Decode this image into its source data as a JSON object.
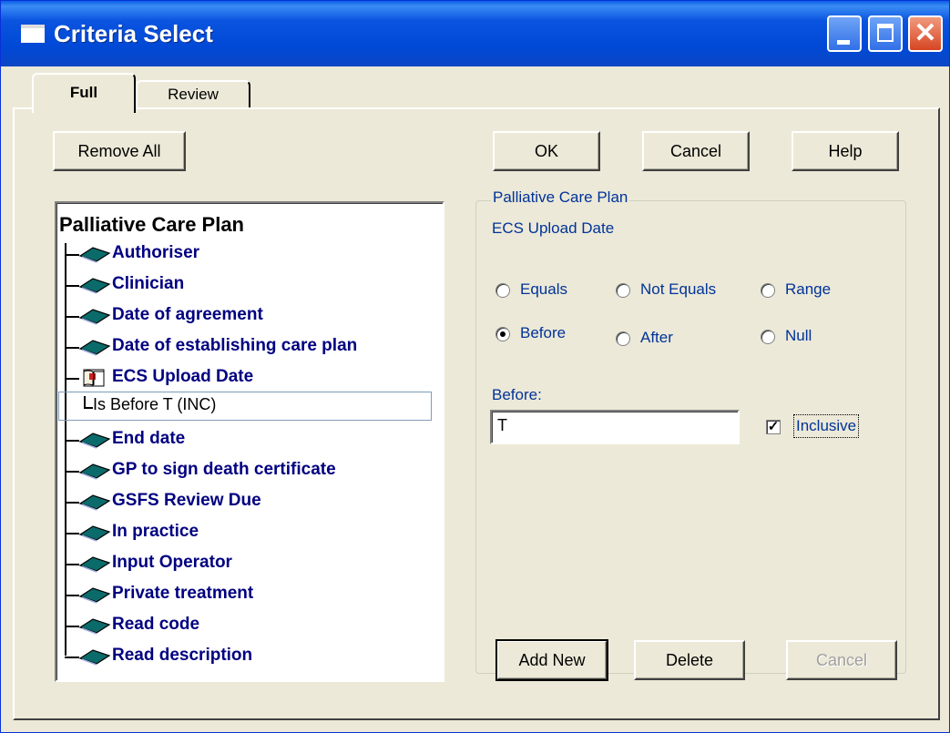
{
  "window": {
    "title": "Criteria Select",
    "icon": "window-icon"
  },
  "tabs": [
    {
      "label": "Full",
      "active": true
    },
    {
      "label": "Review",
      "active": false
    }
  ],
  "buttons": {
    "remove_all": "Remove All",
    "ok": "OK",
    "cancel": "Cancel",
    "help": "Help",
    "add_new": "Add New",
    "delete": "Delete",
    "cancel_edit": "Cancel"
  },
  "tree": {
    "root": "Palliative Care Plan",
    "items": [
      {
        "label": "Authoriser",
        "icon": "book-icon"
      },
      {
        "label": "Clinician",
        "icon": "book-icon"
      },
      {
        "label": "Date of agreement",
        "icon": "book-icon"
      },
      {
        "label": "Date of establishing care plan",
        "icon": "book-icon"
      },
      {
        "label": "ECS Upload Date",
        "icon": "book-selected-icon"
      },
      {
        "label": "End date",
        "icon": "book-icon"
      },
      {
        "label": "GP to sign death certificate",
        "icon": "book-icon"
      },
      {
        "label": "GSFS Review Due",
        "icon": "book-icon"
      },
      {
        "label": "In practice",
        "icon": "book-icon"
      },
      {
        "label": "Input Operator",
        "icon": "book-icon"
      },
      {
        "label": "Private treatment",
        "icon": "book-icon"
      },
      {
        "label": "Read code",
        "icon": "book-icon"
      },
      {
        "label": "Read description",
        "icon": "book-icon"
      }
    ],
    "selected_child": "Is Before T (INC)"
  },
  "criteria": {
    "group_title": "Palliative Care Plan",
    "field_name": "ECS Upload Date",
    "options": [
      {
        "label": "Equals",
        "checked": false
      },
      {
        "label": "Not Equals",
        "checked": false
      },
      {
        "label": "Range",
        "checked": false
      },
      {
        "label": "Before",
        "checked": true
      },
      {
        "label": "After",
        "checked": false
      },
      {
        "label": "Null",
        "checked": false
      }
    ],
    "value_label": "Before:",
    "value": "T",
    "inclusive_label": "Inclusive",
    "inclusive_checked": true
  },
  "colors": {
    "label_blue": "#003399",
    "tree_blue": "#000080",
    "title_blue": "#0054e3",
    "face": "#ece9d8"
  }
}
